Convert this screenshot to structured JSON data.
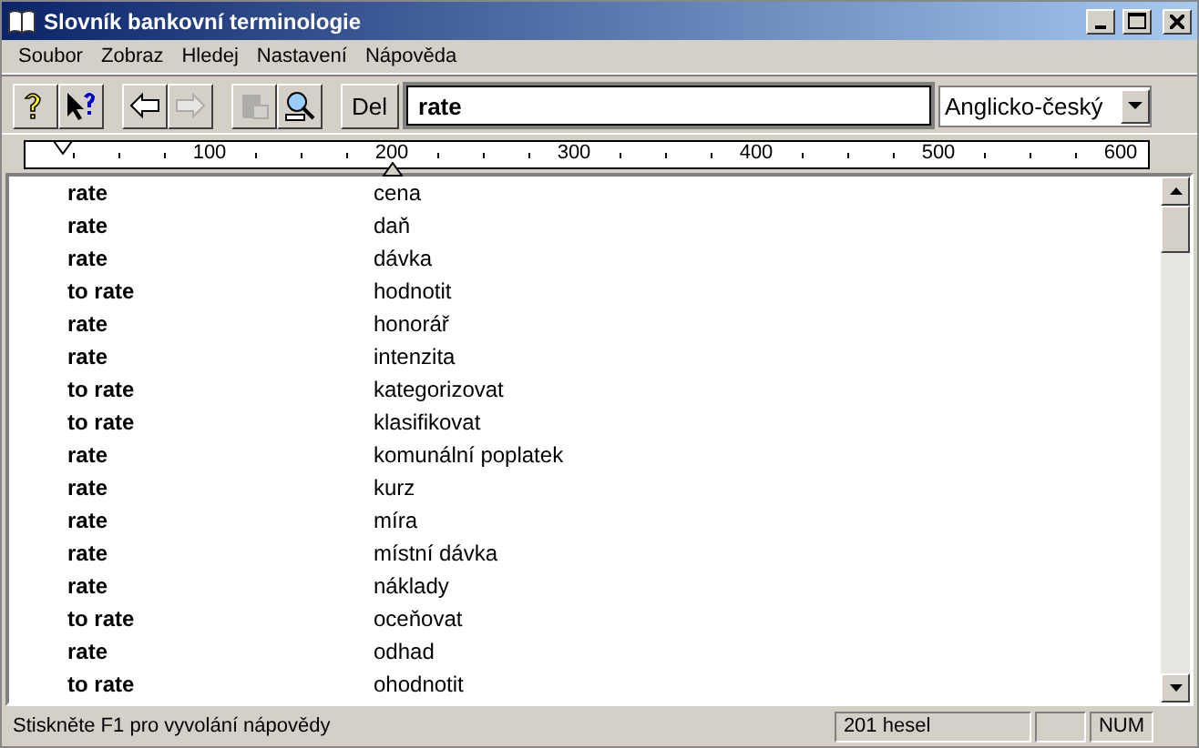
{
  "window": {
    "title": "Slovník bankovní terminologie"
  },
  "menu": [
    "Soubor",
    "Zobraz",
    "Hledej",
    "Nastavení",
    "Nápověda"
  ],
  "toolbar": [
    {
      "kind": "help",
      "disabled": false
    },
    {
      "kind": "context-help",
      "disabled": false
    },
    {
      "kind": "back",
      "disabled": false
    },
    {
      "kind": "forward",
      "disabled": true
    },
    {
      "kind": "copy",
      "disabled": true
    },
    {
      "kind": "find",
      "disabled": false
    }
  ],
  "delete_button": "Del",
  "search": {
    "value": "rate"
  },
  "direction": {
    "value": "Anglicko-český"
  },
  "ruler": [
    "100",
    "200",
    "300",
    "400",
    "500",
    "600"
  ],
  "entries": [
    {
      "term": "rate",
      "translation": "cena"
    },
    {
      "term": "rate",
      "translation": "daň"
    },
    {
      "term": "rate",
      "translation": "dávka"
    },
    {
      "term": "to rate",
      "translation": "hodnotit"
    },
    {
      "term": "rate",
      "translation": "honorář"
    },
    {
      "term": "rate",
      "translation": "intenzita"
    },
    {
      "term": "to rate",
      "translation": "kategorizovat"
    },
    {
      "term": "to rate",
      "translation": "klasifikovat"
    },
    {
      "term": "rate",
      "translation": "komunální poplatek"
    },
    {
      "term": "rate",
      "translation": "kurz"
    },
    {
      "term": "rate",
      "translation": "míra"
    },
    {
      "term": "rate",
      "translation": "místní dávka"
    },
    {
      "term": "rate",
      "translation": "náklady"
    },
    {
      "term": "to rate",
      "translation": "oceňovat"
    },
    {
      "term": "rate",
      "translation": "odhad"
    },
    {
      "term": "to rate",
      "translation": "ohodnotit"
    }
  ],
  "status_bar": {
    "hint": "Stiskněte F1 pro vyvolání nápovědy",
    "count": "201 hesel",
    "num": "NUM"
  }
}
